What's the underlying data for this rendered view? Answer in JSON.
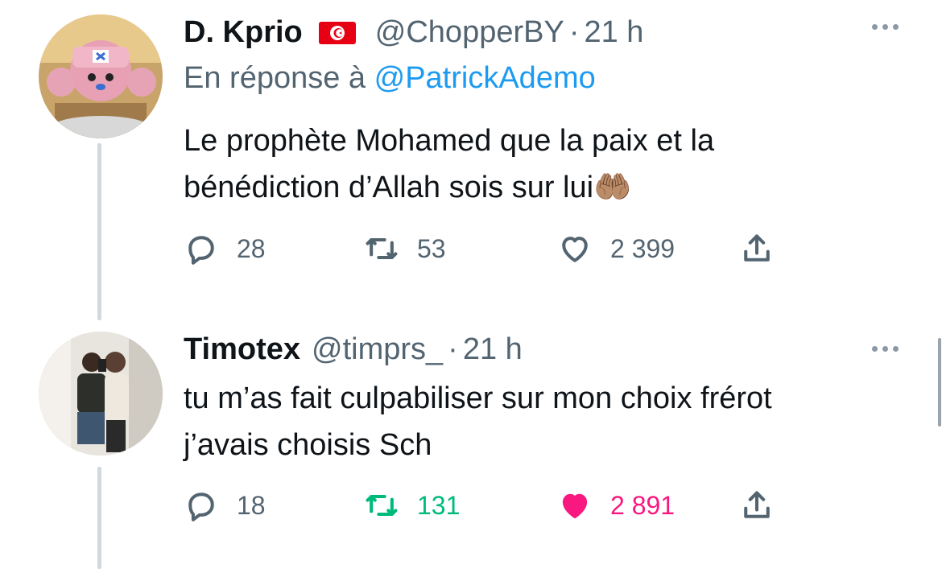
{
  "colors": {
    "text_primary": "#0f1419",
    "text_secondary": "#536471",
    "link": "#1d9bf0",
    "retweet_active": "#00ba7c",
    "like_active": "#f91880",
    "thread_line": "#cfd9de"
  },
  "tweets": [
    {
      "display_name": "D. Kprio",
      "flag_icon": "tunisia-flag-icon",
      "handle": "@ChopperBY",
      "separator": "·",
      "time": "21 h",
      "reply_prefix": "En réponse à",
      "reply_mention": "@PatrickAdemo",
      "lines": [
        "Le prophète Mohamed que la paix et la",
        "bénédiction d’Allah sois sur lui🤲🏽"
      ],
      "actions": {
        "replies": "28",
        "retweets": "53",
        "likes": "2 399",
        "retweeted": false,
        "liked": false
      }
    },
    {
      "display_name": "Timotex",
      "handle": "@timprs_",
      "separator": "·",
      "time": "21 h",
      "lines": [
        "tu m’as fait culpabiliser sur mon choix frérot",
        "j’avais choisis Sch"
      ],
      "actions": {
        "replies": "18",
        "retweets": "131",
        "likes": "2 891",
        "retweeted": true,
        "liked": true
      }
    }
  ]
}
